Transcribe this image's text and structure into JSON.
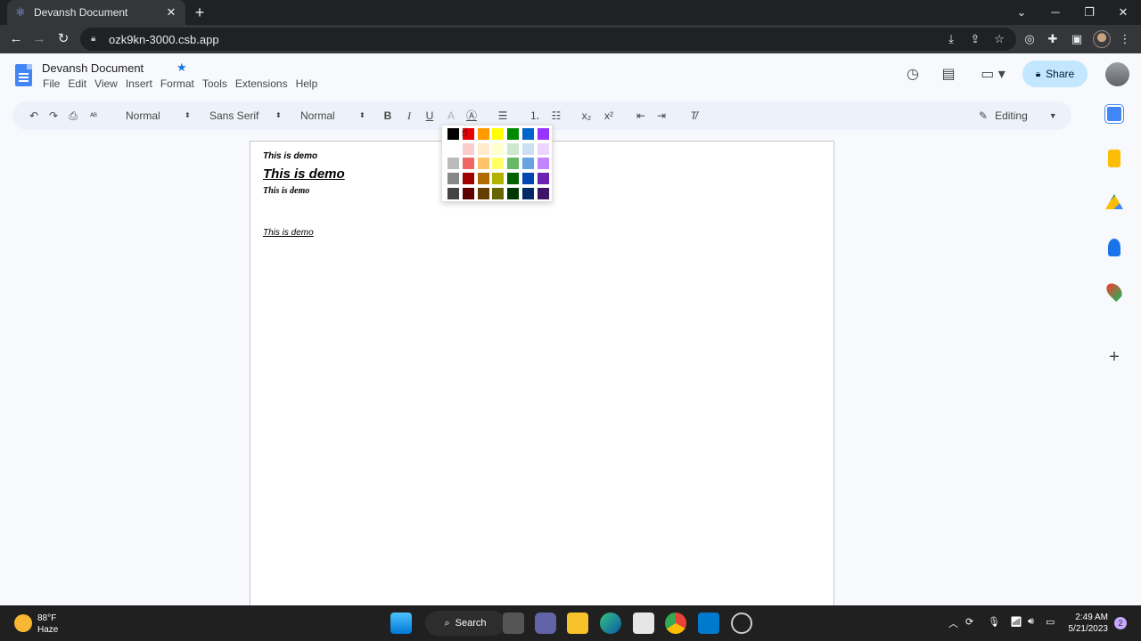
{
  "browser": {
    "tab_title": "Devansh Document",
    "tab_close": "✕",
    "new_tab": "+",
    "url": "ozk9kn-3000.csb.app",
    "window_controls": [
      "─",
      "❐",
      "✕"
    ]
  },
  "docs": {
    "title": "Devansh Document",
    "menu": [
      "File",
      "Edit",
      "View",
      "Insert",
      "Format",
      "Tools",
      "Extensions",
      "Help"
    ],
    "share_label": "Share",
    "mode_label": "Editing"
  },
  "toolbar": {
    "style": "Normal",
    "font": "Sans Serif",
    "size": "Normal",
    "bold": "B",
    "italic": "I",
    "underline": "U",
    "subscript": "x₂",
    "superscript": "x²",
    "clear_format": "T̸"
  },
  "document": {
    "lines": [
      "This is demo",
      "This is demo",
      "This is demo",
      "This is demo"
    ]
  },
  "palette": {
    "rows": [
      [
        "#000000",
        "#e60000",
        "#ff9900",
        "#ffff00",
        "#008a00",
        "#0066cc",
        "#9933ff"
      ],
      [
        "#ffffff",
        "#facccc",
        "#ffebcc",
        "#ffffcc",
        "#cce8cc",
        "#cce0f5",
        "#ebd6ff"
      ],
      [
        "#bbbbbb",
        "#f06666",
        "#ffc266",
        "#ffff66",
        "#66b966",
        "#66a3e0",
        "#c285ff"
      ],
      [
        "#888888",
        "#a10000",
        "#b26b00",
        "#b2b200",
        "#006100",
        "#0047b2",
        "#6b24b2"
      ],
      [
        "#444444",
        "#5c0000",
        "#663d00",
        "#666600",
        "#003700",
        "#002966",
        "#3d1466"
      ]
    ]
  },
  "taskbar": {
    "temp": "88°F",
    "weather": "Haze",
    "search_label": "Search",
    "time": "2:49 AM",
    "date": "5/21/2023",
    "notifications": "2"
  }
}
